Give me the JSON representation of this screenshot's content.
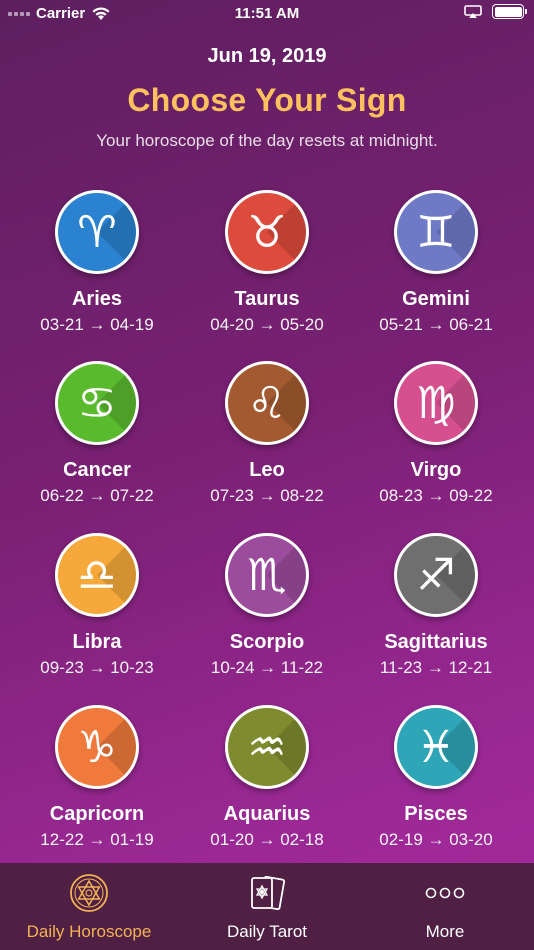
{
  "status": {
    "carrier": "Carrier",
    "time": "11:51 AM"
  },
  "header": {
    "date": "Jun 19, 2019",
    "title": "Choose Your Sign",
    "subtitle": "Your horoscope of the day resets at midnight."
  },
  "signs": [
    {
      "name": "Aries",
      "dates": "03-21 → 04-19",
      "color": "#2a82d0",
      "icon": "ram-icon",
      "glyph": "♈"
    },
    {
      "name": "Taurus",
      "dates": "04-20 → 05-20",
      "color": "#dc4b3c",
      "icon": "bull-icon",
      "glyph": "♉"
    },
    {
      "name": "Gemini",
      "dates": "05-21 → 06-21",
      "color": "#6e7ac6",
      "icon": "twins-icon",
      "glyph": "♊"
    },
    {
      "name": "Cancer",
      "dates": "06-22 → 07-22",
      "color": "#5aba2e",
      "icon": "crayfish-icon",
      "glyph": "♋"
    },
    {
      "name": "Leo",
      "dates": "07-23 → 08-22",
      "color": "#a45a30",
      "icon": "lion-icon",
      "glyph": "♌"
    },
    {
      "name": "Virgo",
      "dates": "08-23 → 09-22",
      "color": "#d6508f",
      "icon": "maiden-icon",
      "glyph": "♍"
    },
    {
      "name": "Libra",
      "dates": "09-23 → 10-23",
      "color": "#f6a93a",
      "icon": "scales-icon",
      "glyph": "♎"
    },
    {
      "name": "Scorpio",
      "dates": "10-24 → 11-22",
      "color": "#9c4c9c",
      "icon": "scorpion-icon",
      "glyph": "♏"
    },
    {
      "name": "Sagittarius",
      "dates": "11-23 → 12-21",
      "color": "#6f6f6f",
      "icon": "bow-arrow-icon",
      "glyph": "♐"
    },
    {
      "name": "Capricorn",
      "dates": "12-22 → 01-19",
      "color": "#ef7a3c",
      "icon": "goat-icon",
      "glyph": "♑"
    },
    {
      "name": "Aquarius",
      "dates": "01-20 → 02-18",
      "color": "#7e8b2e",
      "icon": "water-bearer-icon",
      "glyph": "♒"
    },
    {
      "name": "Pisces",
      "dates": "02-19 → 03-20",
      "color": "#2fa6b8",
      "icon": "fish-icon",
      "glyph": "♓"
    }
  ],
  "tabs": [
    {
      "label": "Daily Horoscope",
      "icon": "hexagram-circle-icon",
      "active": true
    },
    {
      "label": "Daily Tarot",
      "icon": "tarot-cards-icon",
      "active": false
    },
    {
      "label": "More",
      "icon": "more-dots-icon",
      "active": false
    }
  ]
}
